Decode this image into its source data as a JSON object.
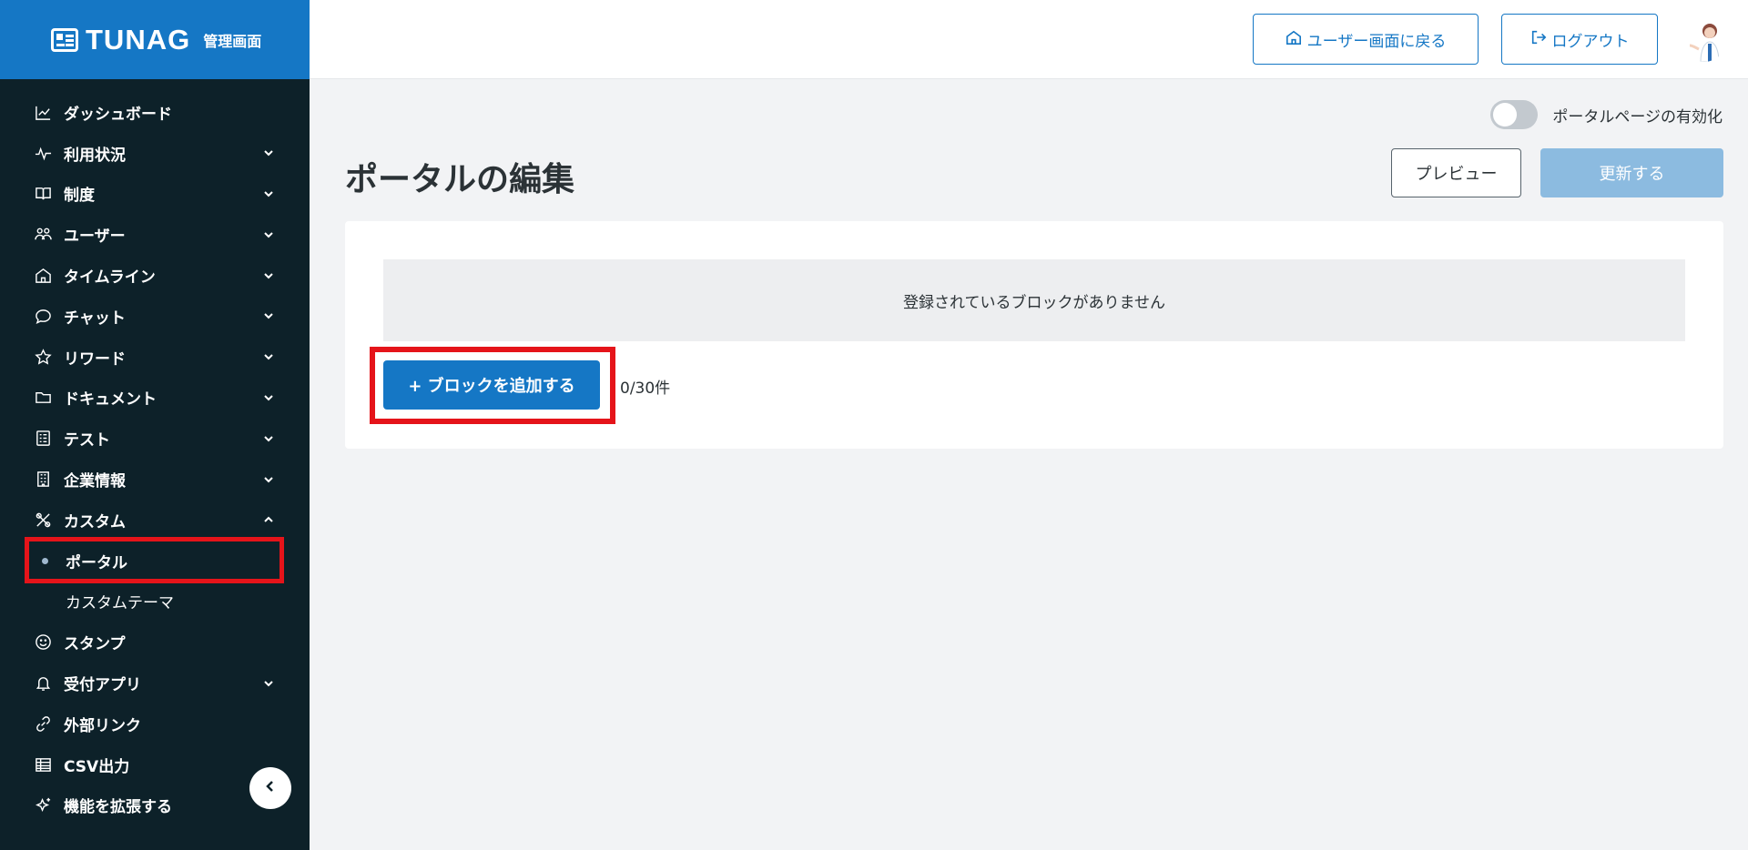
{
  "brand": {
    "name": "TUNAG",
    "subtitle": "管理画面"
  },
  "sidebar": {
    "items": [
      {
        "label": "ダッシュボード",
        "icon": "chart-line-icon",
        "expandable": false
      },
      {
        "label": "利用状況",
        "icon": "activity-icon",
        "expandable": true
      },
      {
        "label": "制度",
        "icon": "book-icon",
        "expandable": true
      },
      {
        "label": "ユーザー",
        "icon": "users-icon",
        "expandable": true
      },
      {
        "label": "タイムライン",
        "icon": "home-icon",
        "expandable": true
      },
      {
        "label": "チャット",
        "icon": "chat-bubble-icon",
        "expandable": true
      },
      {
        "label": "リワード",
        "icon": "star-icon",
        "expandable": true
      },
      {
        "label": "ドキュメント",
        "icon": "folder-icon",
        "expandable": true
      },
      {
        "label": "テスト",
        "icon": "clipboard-icon",
        "expandable": true
      },
      {
        "label": "企業情報",
        "icon": "building-icon",
        "expandable": true
      },
      {
        "label": "カスタム",
        "icon": "tools-icon",
        "expandable": true,
        "expanded": true
      },
      {
        "label": "スタンプ",
        "icon": "smile-icon",
        "expandable": false
      },
      {
        "label": "受付アプリ",
        "icon": "bell-icon",
        "expandable": true
      },
      {
        "label": "外部リンク",
        "icon": "link-icon",
        "expandable": false
      },
      {
        "label": "CSV出力",
        "icon": "table-icon",
        "expandable": false
      },
      {
        "label": "機能を拡張する",
        "icon": "sparkle-icon",
        "expandable": false
      }
    ],
    "custom_children": [
      {
        "label": "ポータル",
        "active": true
      },
      {
        "label": "カスタムテーマ",
        "active": false
      }
    ]
  },
  "header": {
    "back_to_user": "ユーザー画面に戻る",
    "logout": "ログアウト"
  },
  "main": {
    "portal_toggle_label": "ポータルページの有効化",
    "portal_toggle_on": false,
    "title": "ポータルの編集",
    "preview_button": "プレビュー",
    "update_button": "更新する",
    "empty_message": "登録されているブロックがありません",
    "add_block_button": "+ ブロックを追加する",
    "block_count": "0/30件"
  },
  "colors": {
    "brand_blue": "#1577c5",
    "sidebar_bg": "#0d2129",
    "update_disabled": "#8cbbe0",
    "highlight_red": "#e5141a",
    "page_bg": "#f2f3f5"
  }
}
